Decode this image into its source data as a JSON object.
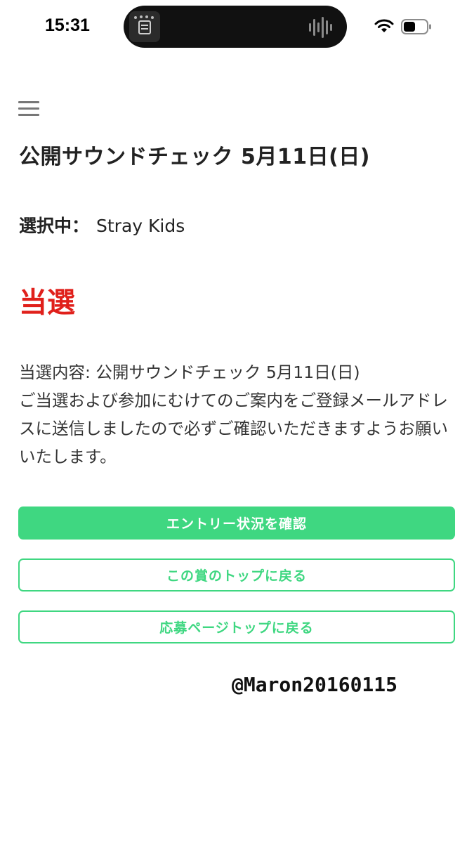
{
  "status_bar": {
    "time": "15:31"
  },
  "page": {
    "title": "公開サウンドチェック 5月11日(日)",
    "selected_label": "選択中：",
    "selected_value": "Stray Kids",
    "result": "当選",
    "result_color": "#e0201b",
    "message_lines": [
      "当選内容: 公開サウンドチェック 5月11日(日)",
      "ご当選および参加にむけてのご案内をご登録メールアドレスに送信しましたので必ずご確認いただきますようお願いいたします。"
    ]
  },
  "buttons": {
    "entry_status": "エントリー状況を確認",
    "award_top": "この賞のトップに戻る",
    "apply_top": "応募ページトップに戻る"
  },
  "theme": {
    "accent": "#3fd781"
  },
  "watermark": "@Maron20160115",
  "icons": {
    "menu": "hamburger-icon",
    "wifi": "wifi-icon",
    "battery": "battery-icon",
    "audio": "audio-waveform-icon"
  }
}
